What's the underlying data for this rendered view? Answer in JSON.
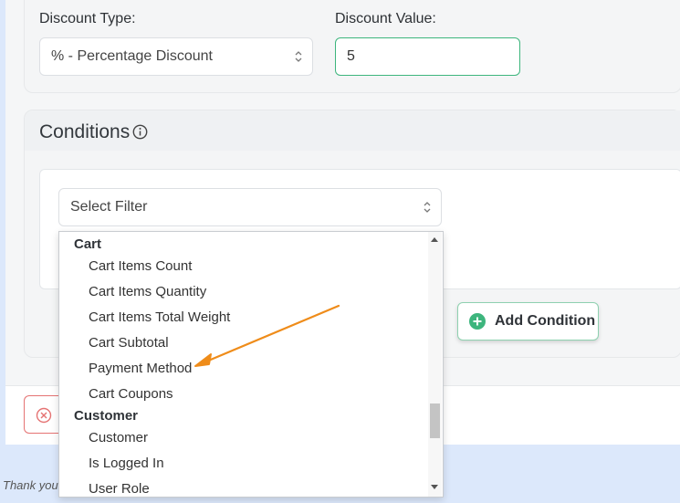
{
  "discount": {
    "type_label": "Discount Type:",
    "type_value": "% - Percentage Discount",
    "value_label": "Discount Value:",
    "value": "5"
  },
  "conditions": {
    "title": "Conditions",
    "filter_placeholder": "Select Filter",
    "add_label": "Add Condition"
  },
  "dropdown": {
    "groups": [
      {
        "label": "Cart",
        "items": [
          "Cart Items Count",
          "Cart Items Quantity",
          "Cart Items Total Weight",
          "Cart Subtotal",
          "Payment Method",
          "Cart Coupons"
        ]
      },
      {
        "label": "Customer",
        "items": [
          "Customer",
          "Is Logged In",
          "User Role"
        ]
      }
    ]
  },
  "footer": {
    "thanks": "Thank you"
  },
  "colors": {
    "accent": "#3db57d",
    "cancel": "#e57373",
    "annotation_arrow": "#ef8c1a"
  },
  "icons": [
    "updown-icon",
    "info-icon",
    "plus-circle-icon",
    "close-circle-icon",
    "annotation-arrow"
  ]
}
